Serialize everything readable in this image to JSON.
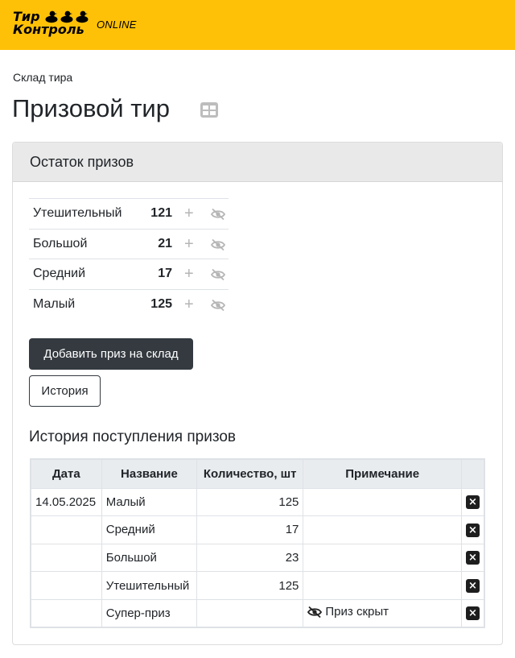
{
  "header": {
    "logo_line1": "Тир",
    "logo_line2": "Контроль",
    "online": "ONLINE"
  },
  "breadcrumb": "Склад тира",
  "page_title": "Призовой тир",
  "card": {
    "title": "Остаток призов",
    "stock": [
      {
        "name": "Утешительный",
        "count": "121"
      },
      {
        "name": "Большой",
        "count": "21"
      },
      {
        "name": "Средний",
        "count": "17"
      },
      {
        "name": "Малый",
        "count": "125"
      }
    ],
    "add_button": "Добавить приз на склад",
    "history_button": "История"
  },
  "history": {
    "title": "История поступления призов",
    "columns": {
      "date": "Дата",
      "name": "Название",
      "qty": "Количество, шт",
      "note": "Примечание"
    },
    "rows": [
      {
        "date": "14.05.2025",
        "name": "Малый",
        "qty": "125",
        "note": ""
      },
      {
        "date": "",
        "name": "Средний",
        "qty": "17",
        "note": ""
      },
      {
        "date": "",
        "name": "Большой",
        "qty": "23",
        "note": ""
      },
      {
        "date": "",
        "name": "Утешительный",
        "qty": "125",
        "note": ""
      },
      {
        "date": "",
        "name": "Супер-приз",
        "qty": "",
        "note": "Приз скрыт"
      }
    ],
    "delete_glyph": "×"
  },
  "icons": {
    "plus": "plus-icon",
    "hide": "eye-slash-icon",
    "delete": "close-icon",
    "table": "table-icon"
  },
  "colors": {
    "brand_yellow": "#ffc107",
    "dark_button": "#343a40",
    "muted_icon": "#b5b5b5"
  }
}
